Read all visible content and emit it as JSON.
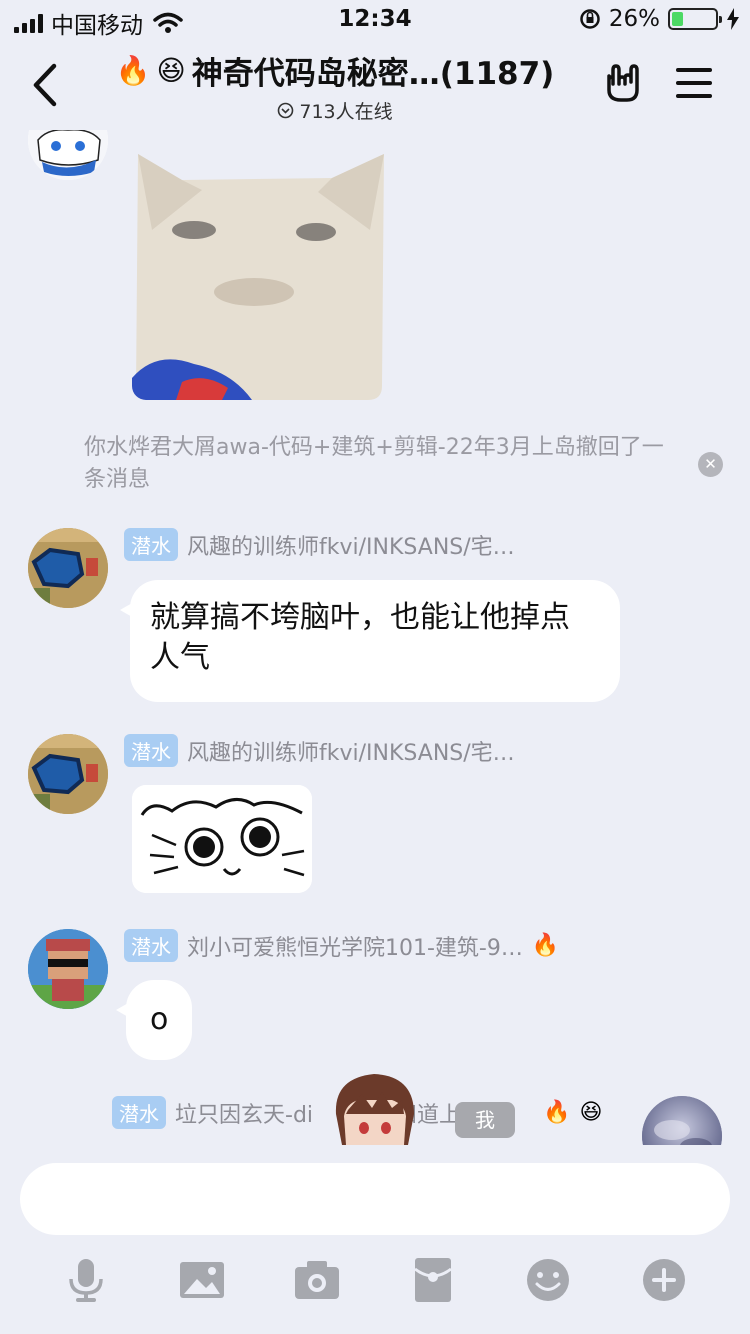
{
  "status": {
    "carrier": "中国移动",
    "time": "12:34",
    "battery": "26%",
    "battery_level": 0.26
  },
  "header": {
    "title": "神奇代码岛秘密…(1187)",
    "online": "713人在线"
  },
  "chat": {
    "recall_notice": "你水烨君大屑awa-代码+建筑+剪辑-22年3月上岛撤回了一条消息",
    "messages": [
      {
        "badge": "潜水",
        "sender": "风趣的训练师fkvi/INKSANS/宅…",
        "text": "就算搞不垮脑叶，也能让他掉点人气"
      },
      {
        "badge": "潜水",
        "sender": "风趣的训练师fkvi/INKSANS/宅…"
      },
      {
        "badge": "潜水",
        "sender": "刘小可爱熊恒光学院101-建筑-9…",
        "text": "o"
      },
      {
        "badge": "潜水",
        "sender": "垃只因玄天-di",
        "sender_tail": "知道上岛…"
      }
    ],
    "me_label": "我"
  },
  "input": {
    "placeholder": ""
  },
  "icons": {
    "back": "chevron-left-icon",
    "hand": "rock-hand-icon",
    "menu": "hamburger-menu-icon",
    "mic": "microphone-icon",
    "image": "image-icon",
    "camera": "camera-icon",
    "redpacket": "red-packet-icon",
    "emoji": "emoji-icon",
    "plus": "plus-icon"
  },
  "colors": {
    "background": "#eceef6",
    "badge": "#a9cdf3",
    "icon_gray": "#a6a8ae"
  }
}
